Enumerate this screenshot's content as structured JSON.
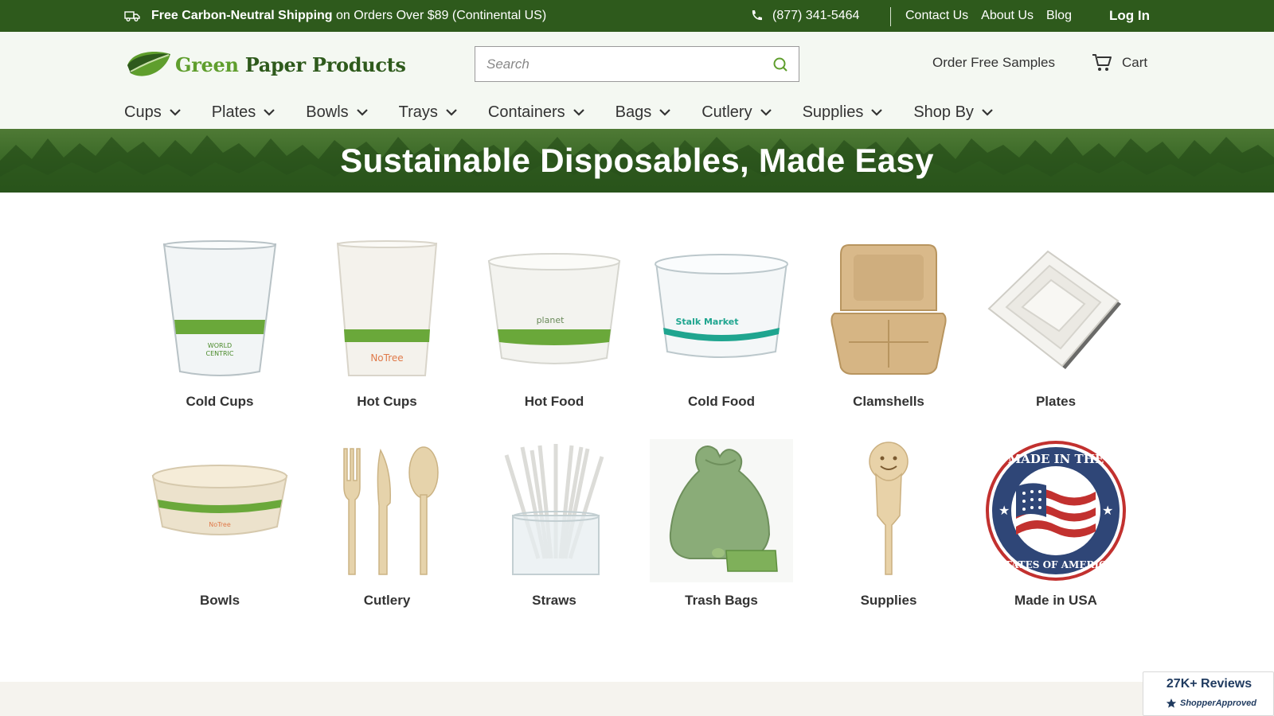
{
  "topbar": {
    "shipping_bold": "Free Carbon-Neutral Shipping",
    "shipping_rest": " on Orders Over $89 (Continental US)",
    "phone": "(877) 341-5464",
    "links": [
      "Contact Us",
      "About Us",
      "Blog"
    ],
    "login": "Log In"
  },
  "header": {
    "brand_part1": "Green",
    "brand_part2": "Paper Products",
    "search_placeholder": "Search",
    "order_samples": "Order Free Samples",
    "cart": "Cart"
  },
  "nav": [
    "Cups",
    "Plates",
    "Bowls",
    "Trays",
    "Containers",
    "Bags",
    "Cutlery",
    "Supplies",
    "Shop By"
  ],
  "hero": {
    "title": "Sustainable Disposables, Made Easy"
  },
  "categories": [
    {
      "label": "Cold Cups",
      "icon": "clear-cup-icon"
    },
    {
      "label": "Hot Cups",
      "icon": "paper-cup-icon"
    },
    {
      "label": "Hot Food",
      "icon": "food-container-icon"
    },
    {
      "label": "Cold Food",
      "icon": "deli-container-icon"
    },
    {
      "label": "Clamshells",
      "icon": "clamshell-icon"
    },
    {
      "label": "Plates",
      "icon": "plates-icon"
    },
    {
      "label": "Bowls",
      "icon": "bowl-icon"
    },
    {
      "label": "Cutlery",
      "icon": "cutlery-icon"
    },
    {
      "label": "Straws",
      "icon": "straws-icon"
    },
    {
      "label": "Trash Bags",
      "icon": "trash-bag-icon"
    },
    {
      "label": "Supplies",
      "icon": "wooden-spoon-icon"
    },
    {
      "label": "Made in USA",
      "icon": "made-in-usa-seal-icon"
    }
  ],
  "reviews": {
    "count": "27K+ Reviews",
    "provider": "ShopperApproved"
  },
  "colors": {
    "topbar": "#2e5a1c",
    "brand_light": "#5f9e2d",
    "brand_dark": "#2e5a1c",
    "header_bg": "#f4f8f2"
  }
}
